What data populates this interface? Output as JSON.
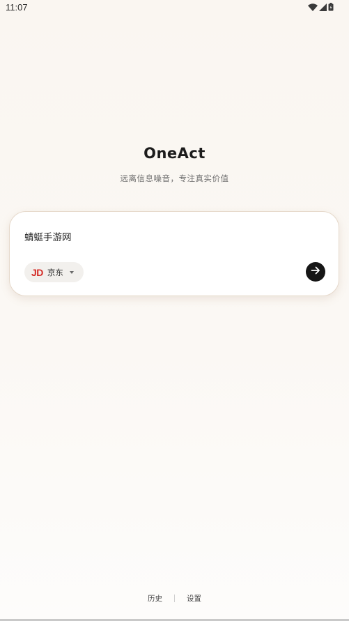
{
  "status_bar": {
    "time": "11:07",
    "icons": [
      "wifi-icon",
      "signal-icon",
      "battery-icon"
    ]
  },
  "header": {
    "title": "OneAct",
    "subtitle": "远离信息噪音，专注真实价值"
  },
  "search": {
    "query": "蜻蜓手游网",
    "platform": {
      "logo_text": "JD",
      "label": "京东",
      "logo_color": "#d42a25"
    },
    "submit_icon": "arrow-right-icon"
  },
  "footer": {
    "history_label": "历史",
    "settings_label": "设置"
  },
  "colors": {
    "background": "#faf6f1",
    "card_border": "#e6d9cb",
    "submit_button": "#161616"
  }
}
